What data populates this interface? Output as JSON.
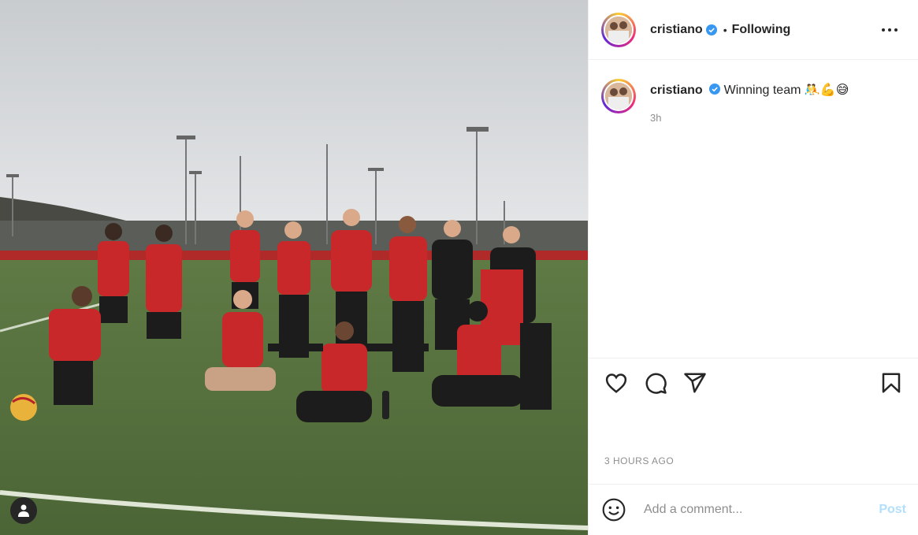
{
  "post": {
    "username": "cristiano",
    "dot": "•",
    "follow_status": "Following",
    "caption_text": "Winning team",
    "caption_emoji": "🤼💪😅",
    "relative_time": "3h",
    "timestamp": "3 HOURS AGO"
  },
  "comment_box": {
    "placeholder": "Add a comment...",
    "post_label": "Post"
  },
  "icons": {
    "more": "more-options-icon",
    "like": "heart-icon",
    "comment": "comment-icon",
    "share": "send-icon",
    "save": "bookmark-icon",
    "emoji": "emoji-smiley-icon",
    "user": "user-tag-icon",
    "verified": "verified-badge-icon"
  },
  "colors": {
    "verified": "#3897f0",
    "post_disabled": "#b2dffc",
    "muted": "#8e8e8e",
    "text": "#262626"
  }
}
